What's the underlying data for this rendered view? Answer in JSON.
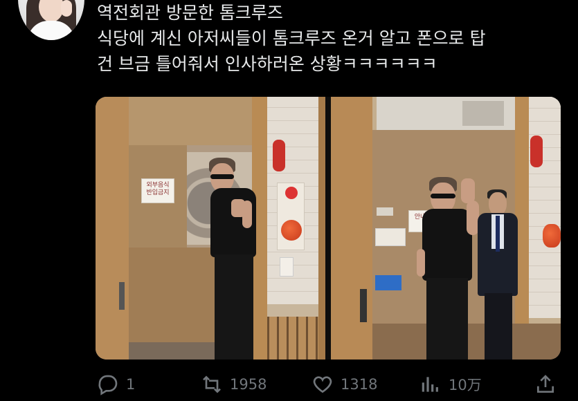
{
  "tweet": {
    "text_lines": [
      "역전회관 방문한 톰크루즈",
      "식당에 계신 아저씨들이 톰크루즈 온거 알고 폰으로 탑",
      "건 브금 틀어줘서 인사하러온 상황ㅋㅋㅋㅋㅋㅋ"
    ]
  },
  "media": {
    "left_photo": {
      "sign_text": "외부음식\n반입금지"
    },
    "right_photo": {
      "sign_text": "안내"
    }
  },
  "actions": {
    "reply": {
      "icon": "reply-icon",
      "count": "1"
    },
    "retweet": {
      "icon": "retweet-icon",
      "count": "1958"
    },
    "like": {
      "icon": "heart-icon",
      "count": "1318"
    },
    "views": {
      "icon": "views-icon",
      "count": "10万"
    },
    "share": {
      "icon": "share-icon"
    }
  },
  "colors": {
    "background": "#000000",
    "text": "#e7e9ea",
    "muted": "#71767b"
  }
}
